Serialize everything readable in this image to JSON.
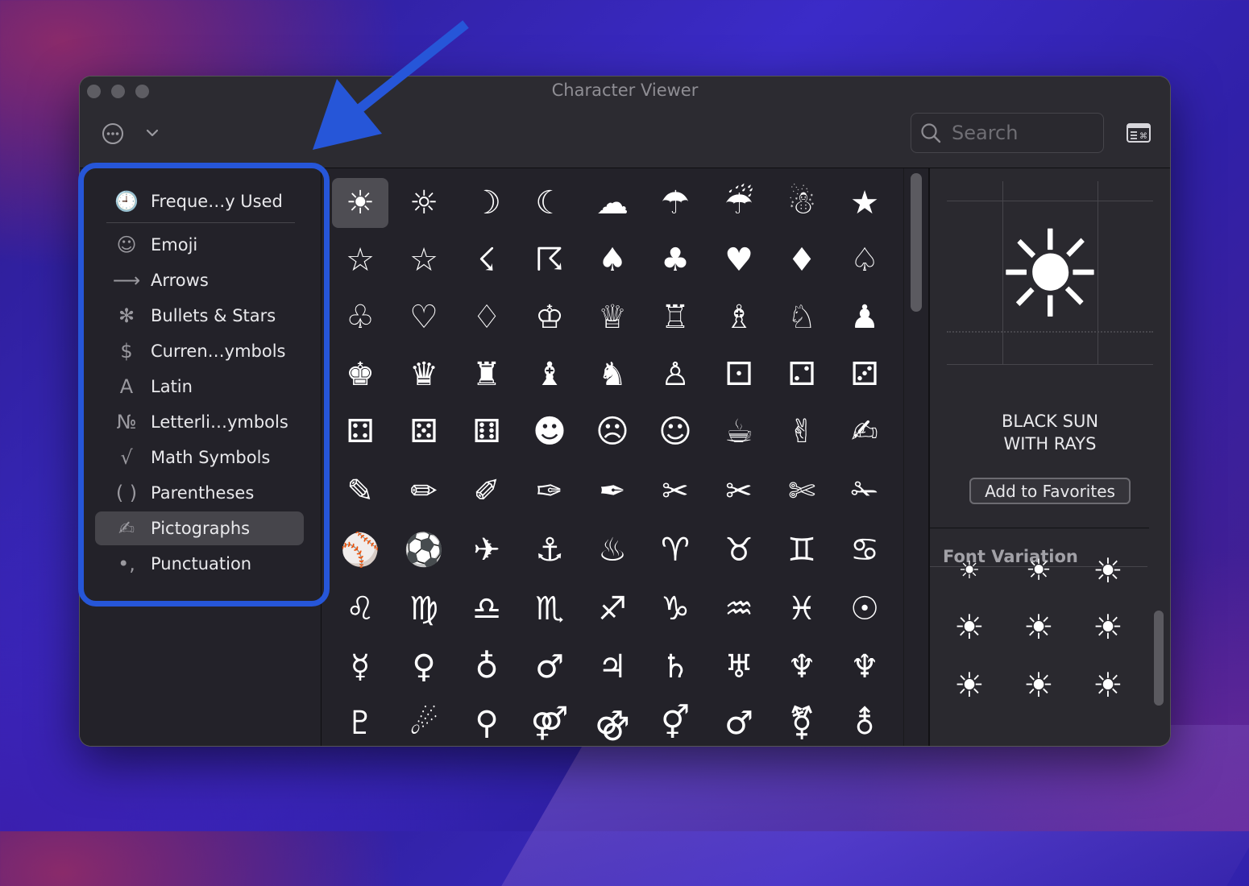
{
  "window": {
    "title": "Character Viewer"
  },
  "toolbar": {
    "search_placeholder": "Search"
  },
  "sidebar": {
    "items": [
      {
        "label": "Freque…y Used",
        "icon": "clock-icon",
        "glyph": "🕘"
      },
      {
        "label": "Emoji",
        "icon": "smiley-icon",
        "glyph": "☺"
      },
      {
        "label": "Arrows",
        "icon": "arrow-icon",
        "glyph": "⟶"
      },
      {
        "label": "Bullets & Stars",
        "icon": "asterisk-icon",
        "glyph": "✻"
      },
      {
        "label": "Curren…ymbols",
        "icon": "dollar-icon",
        "glyph": "$"
      },
      {
        "label": "Latin",
        "icon": "latin-a-icon",
        "glyph": "A"
      },
      {
        "label": "Letterli…ymbols",
        "icon": "numero-icon",
        "glyph": "№"
      },
      {
        "label": "Math Symbols",
        "icon": "square-root-icon",
        "glyph": "√"
      },
      {
        "label": "Parentheses",
        "icon": "parentheses-icon",
        "glyph": "( )"
      },
      {
        "label": "Pictographs",
        "icon": "writing-hand-icon",
        "glyph": "✍"
      },
      {
        "label": "Punctuation",
        "icon": "punctuation-icon",
        "glyph": "•,"
      }
    ],
    "selected": "Pictographs"
  },
  "grid": {
    "rows": [
      [
        "☀",
        "☼",
        "☽",
        "☾",
        "☁",
        "☂",
        "☔",
        "☃",
        "★"
      ],
      [
        "☆",
        "☆",
        "☇",
        "☈",
        "♠",
        "♣",
        "♥",
        "♦",
        "♤"
      ],
      [
        "♧",
        "♡",
        "♢",
        "♔",
        "♕",
        "♖",
        "♗",
        "♘",
        "♟"
      ],
      [
        "♚",
        "♛",
        "♜",
        "♝",
        "♞",
        "♙",
        "⚀",
        "⚁",
        "⚂"
      ],
      [
        "⚃",
        "⚄",
        "⚅",
        "☻",
        "☹",
        "☺",
        "☕",
        "✌",
        "✍"
      ],
      [
        "✎",
        "✏",
        "✐",
        "✑",
        "✒",
        "✂",
        "✂",
        "✄",
        "✁"
      ],
      [
        "⚾",
        "⚽",
        "✈",
        "⚓",
        "♨",
        "♈",
        "♉",
        "♊",
        "♋"
      ],
      [
        "♌",
        "♍",
        "♎",
        "♏",
        "♐",
        "♑",
        "♒",
        "♓",
        "☉"
      ],
      [
        "☿",
        "♀",
        "♁",
        "♂",
        "♃",
        "♄",
        "♅",
        "♆",
        "♆"
      ],
      [
        "♇",
        "☄",
        "⚲",
        "⚤",
        "⚣",
        "⚥",
        "♂",
        "⚧",
        "⚨"
      ]
    ],
    "selected_index": [
      0,
      0
    ]
  },
  "inspector": {
    "character": "☀",
    "name": "BLACK SUN\nWITH RAYS",
    "add_favorites_label": "Add to Favorites",
    "font_variation_label": "Font Variation",
    "variations": [
      "☀",
      "☀",
      "☀",
      "☀",
      "☀",
      "☀",
      "☀",
      "☀",
      "☀"
    ]
  },
  "annotation": {
    "color": "#2656d8"
  },
  "colors": {
    "window_bg": "#232229",
    "selection": "#46454b",
    "text": "#e9e9ec"
  }
}
